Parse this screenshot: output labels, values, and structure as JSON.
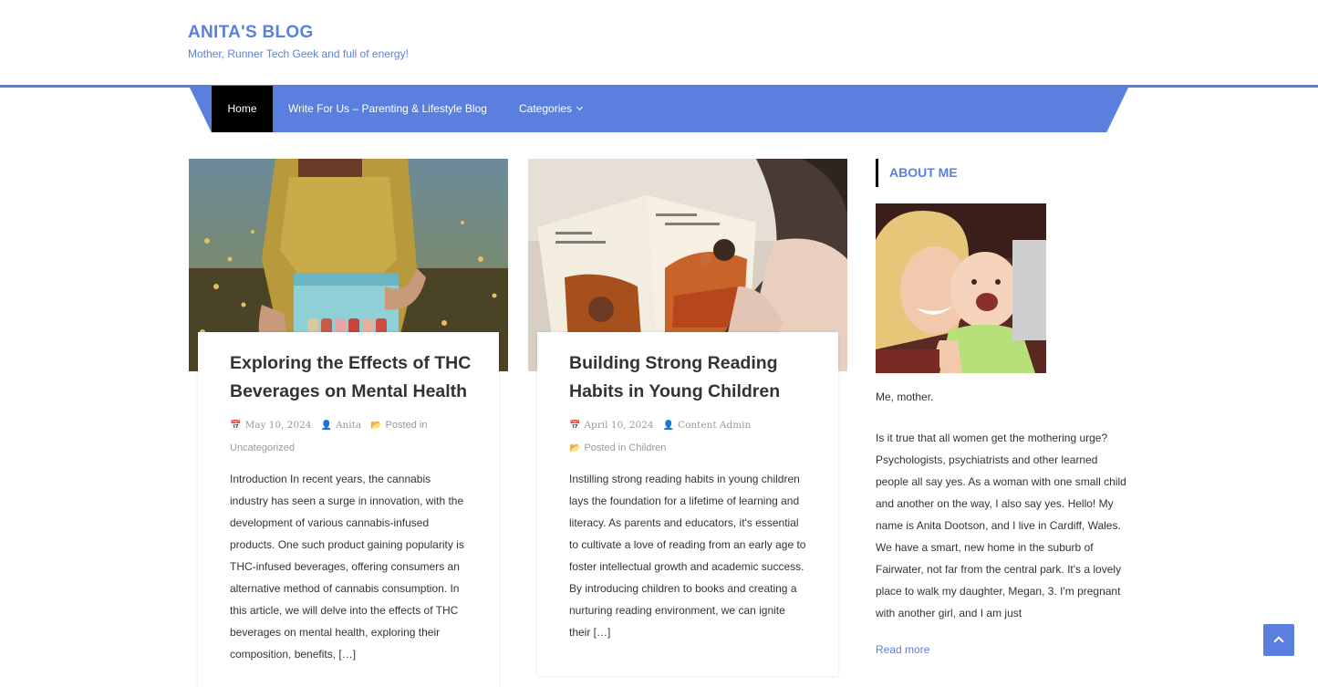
{
  "site": {
    "title": "ANITA'S BLOG",
    "tagline": "Mother, Runner Tech Geek and full of energy!"
  },
  "nav": {
    "items": [
      {
        "label": "Home",
        "active": true
      },
      {
        "label": "Write For Us – Parenting & Lifestyle Blog"
      },
      {
        "label": "Categories",
        "has_dropdown": true
      }
    ]
  },
  "posts": [
    {
      "title": "Exploring the Effects of THC Beverages on Mental Health",
      "date": "May 10, 2024",
      "author": "Anita",
      "posted_in_label": "Posted in",
      "category": "Uncategorized",
      "excerpt": "Introduction In recent years, the cannabis industry has seen a surge in innovation, with the development of various cannabis-infused products. One such product gaining popularity is THC-infused beverages, offering consumers an alternative method of cannabis consumption. In this article, we will delve into the effects of THC beverages on mental health, exploring their composition, benefits, […]"
    },
    {
      "title": "Building Strong Reading Habits in Young Children",
      "date": "April 10, 2024",
      "author": "Content Admin",
      "posted_in_label": "Posted in",
      "category": "Children",
      "excerpt": "Instilling strong reading habits in young children lays the foundation for a lifetime of learning and literacy. As parents and educators, it's essential to cultivate a love of reading from an early age to foster intellectual growth and academic success. By introducing children to books and creating a nurturing reading environment, we can ignite their […]"
    }
  ],
  "sidebar": {
    "title": "ABOUT ME",
    "caption": "Me, mother.",
    "text": "Is it true that all women get the mothering urge? Psychologists, psychiatrists and other learned people all say yes. As a woman with one small child and another on the way, I also say yes. Hello! My name is Anita Dootson, and I live in Cardiff, Wales. We have a smart, new home in the suburb of Fairwater, not far from the central park. It's a lovely place to walk my daughter, Megan, 3. I'm pregnant with another girl, and I am just",
    "read_more": "Read more"
  },
  "icons": {
    "date": "calendar-icon",
    "author": "user-icon",
    "category": "folder-icon",
    "scroll_top": "chevron-up-icon"
  },
  "colors": {
    "accent": "#5b7fde",
    "nav_active": "#000000",
    "meta": "#999999"
  }
}
